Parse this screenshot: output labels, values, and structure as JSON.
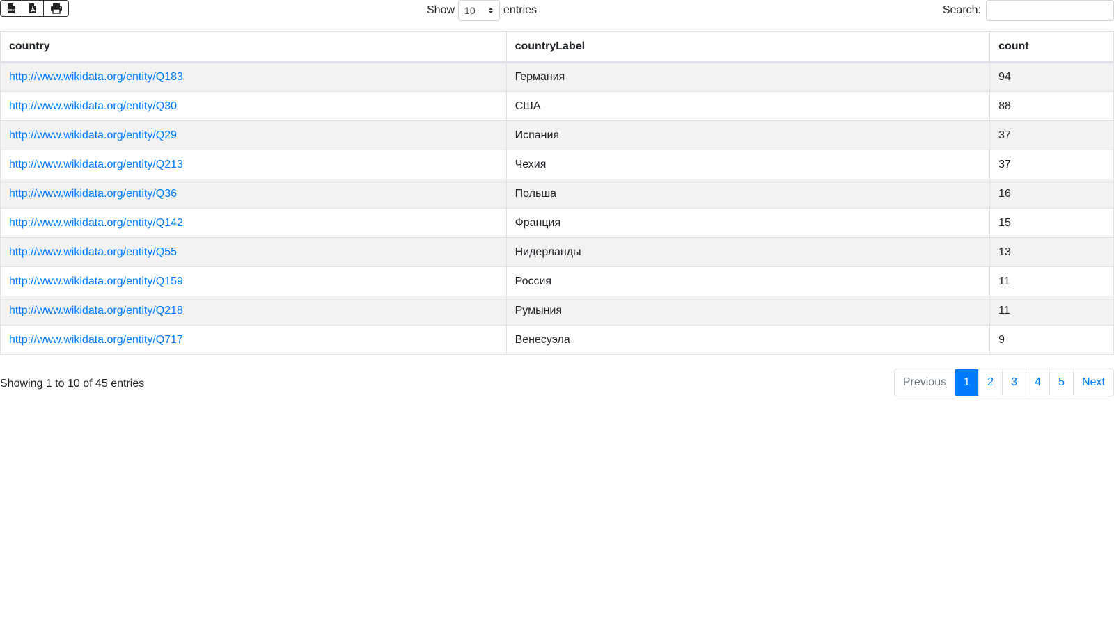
{
  "toolbar": {
    "export_buttons": [
      {
        "name": "csv-icon"
      },
      {
        "name": "pdf-icon"
      },
      {
        "name": "print-icon"
      }
    ]
  },
  "length": {
    "show_label": "Show",
    "value": "10",
    "entries_label": "entries"
  },
  "search": {
    "label": "Search:",
    "value": "",
    "placeholder": ""
  },
  "table": {
    "columns": [
      "country",
      "countryLabel",
      "count"
    ],
    "rows": [
      {
        "country": "http://www.wikidata.org/entity/Q183",
        "label": "Германия",
        "count": "94"
      },
      {
        "country": "http://www.wikidata.org/entity/Q30",
        "label": "США",
        "count": "88"
      },
      {
        "country": "http://www.wikidata.org/entity/Q29",
        "label": "Испания",
        "count": "37"
      },
      {
        "country": "http://www.wikidata.org/entity/Q213",
        "label": "Чехия",
        "count": "37"
      },
      {
        "country": "http://www.wikidata.org/entity/Q36",
        "label": "Польша",
        "count": "16"
      },
      {
        "country": "http://www.wikidata.org/entity/Q142",
        "label": "Франция",
        "count": "15"
      },
      {
        "country": "http://www.wikidata.org/entity/Q55",
        "label": "Нидерланды",
        "count": "13"
      },
      {
        "country": "http://www.wikidata.org/entity/Q159",
        "label": "Россия",
        "count": "11"
      },
      {
        "country": "http://www.wikidata.org/entity/Q218",
        "label": "Румыния",
        "count": "11"
      },
      {
        "country": "http://www.wikidata.org/entity/Q717",
        "label": "Венесуэла",
        "count": "9"
      }
    ]
  },
  "info": "Showing 1 to 10 of 45 entries",
  "pagination": {
    "previous": "Previous",
    "pages": [
      "1",
      "2",
      "3",
      "4",
      "5"
    ],
    "active_page": "1",
    "next": "Next"
  },
  "colors": {
    "link": "#007bff",
    "active_page_bg": "#007bff",
    "striped_row": "#f2f2f2"
  }
}
